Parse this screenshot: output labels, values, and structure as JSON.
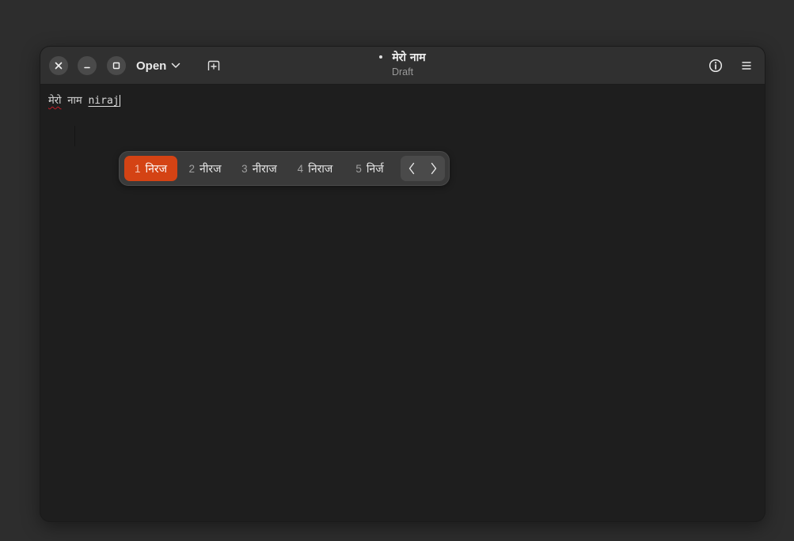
{
  "window": {
    "title": "मेरो नाम",
    "subtitle": "Draft",
    "open_label": "Open",
    "modified": true
  },
  "editor": {
    "word1": "मेरो",
    "word2": "नाम",
    "preedit": "niraj"
  },
  "ime": {
    "candidates": [
      {
        "num": "1",
        "text": "निरज",
        "selected": true
      },
      {
        "num": "2",
        "text": "नीरज",
        "selected": false
      },
      {
        "num": "3",
        "text": "नीराज",
        "selected": false
      },
      {
        "num": "4",
        "text": "निराज",
        "selected": false
      },
      {
        "num": "5",
        "text": "निर्ज",
        "selected": false
      }
    ]
  },
  "colors": {
    "accent": "#d44314",
    "headerbar": "#303030",
    "editor_bg": "#1e1e1e",
    "popup_bg": "#3a3a3a"
  },
  "icons": {
    "close": "close-icon",
    "minimize": "minimize-icon",
    "maximize": "maximize-icon",
    "open_dropdown": "chevron-down-icon",
    "new_tab": "new-tab-icon",
    "info": "info-icon",
    "menu": "hamburger-menu-icon",
    "prev_page": "chevron-left-icon",
    "next_page": "chevron-right-icon"
  }
}
